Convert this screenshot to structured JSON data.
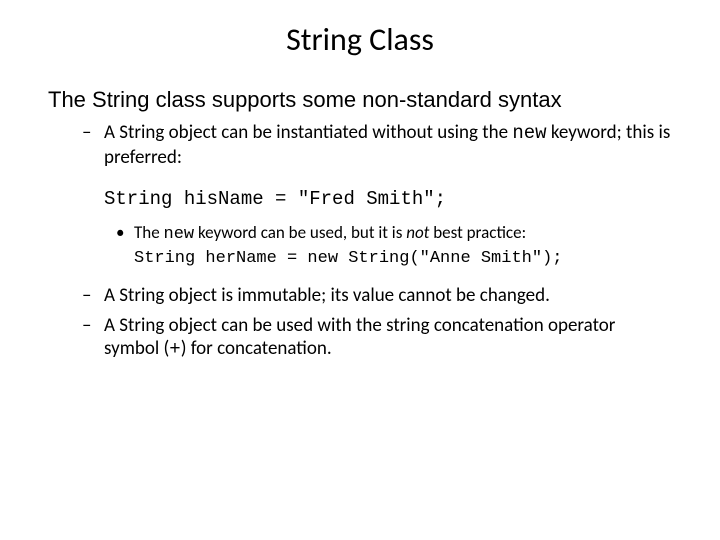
{
  "title": "String Class",
  "intro": "The String class supports some non-standard syntax",
  "b1_pre": "A String object can be instantiated without using the ",
  "b1_kw": "new",
  "b1_post": " keyword; this is preferred:",
  "code1": "String hisName = \"Fred Smith\";",
  "sub_pre": "The ",
  "sub_kw": "new",
  "sub_mid": " keyword can be used, but it is ",
  "sub_not": "not",
  "sub_post": " best practice:",
  "code2": "String herName = new String(\"Anne Smith\");",
  "b2": "A String object is immutable; its value cannot be changed.",
  "b3_pre": "A String object can be used with the string concatenation operator symbol (",
  "b3_op": "+",
  "b3_post": ") for concatenation."
}
